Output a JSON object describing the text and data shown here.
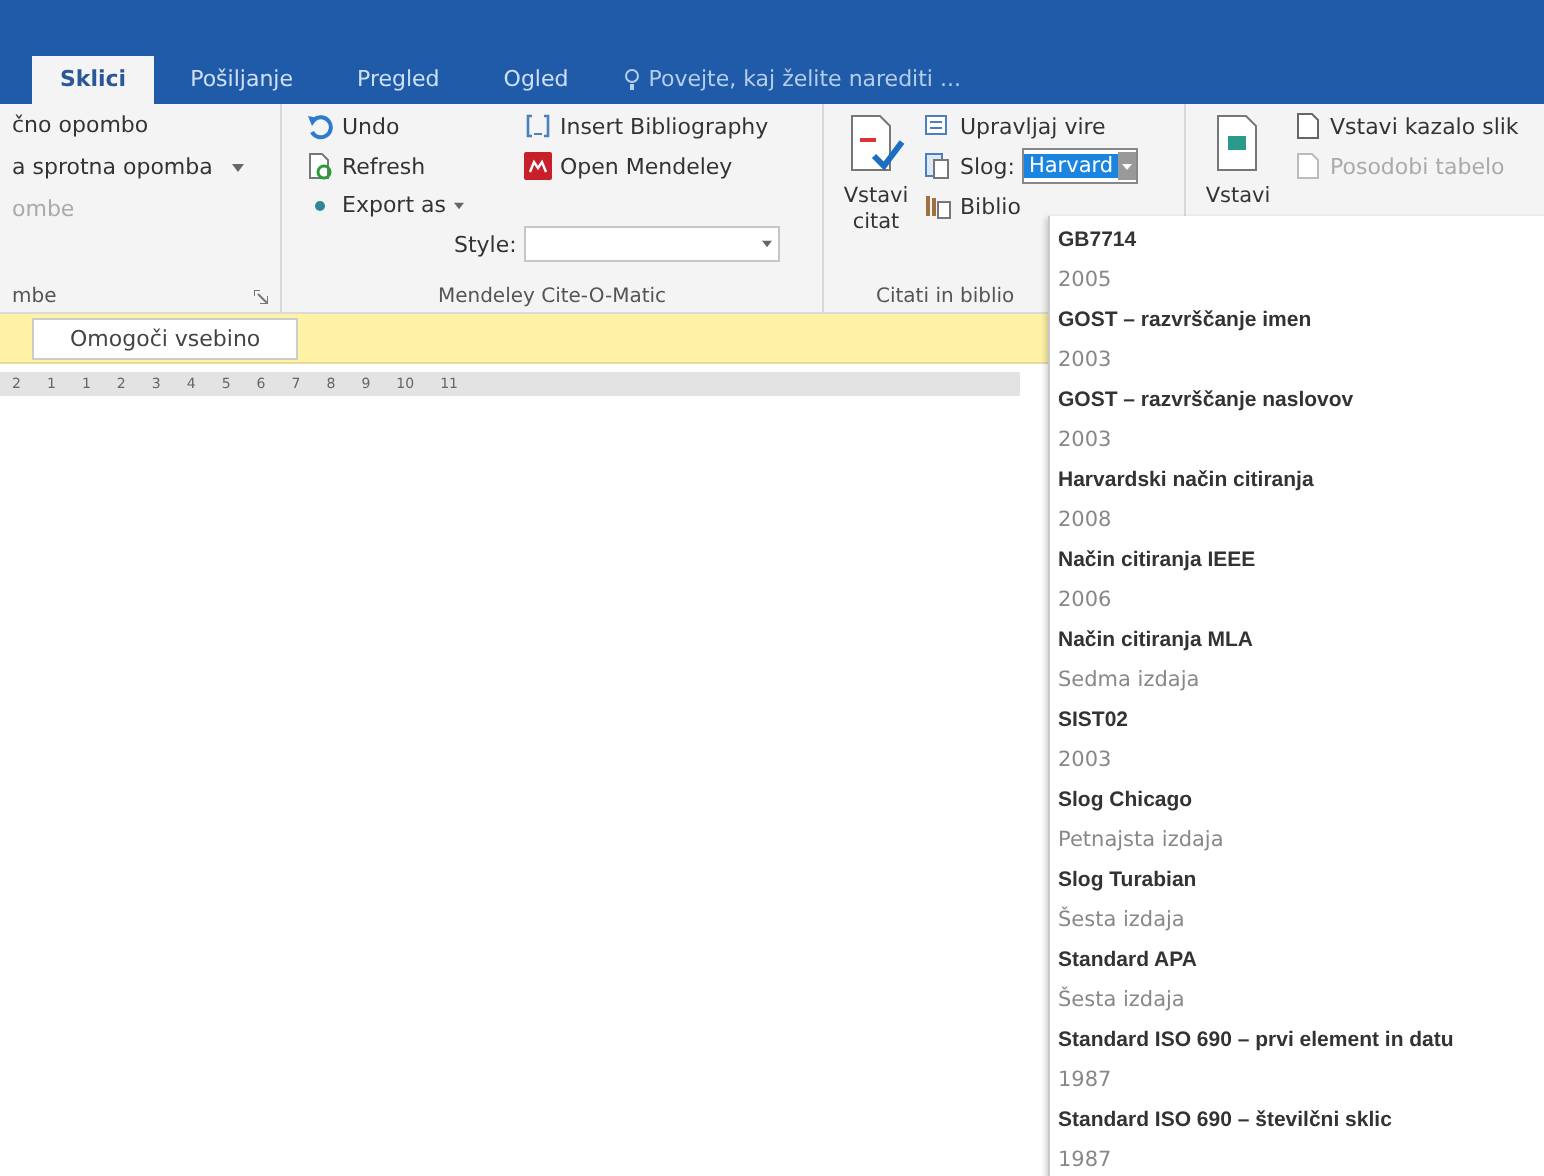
{
  "tabs": [
    {
      "label": "Sklici",
      "selected": true
    },
    {
      "label": "Pošiljanje",
      "selected": false
    },
    {
      "label": "Pregled",
      "selected": false
    },
    {
      "label": "Ogled",
      "selected": false
    }
  ],
  "tell_me": "Povejte, kaj želite narediti ...",
  "ribbon": {
    "footnotes": {
      "items": [
        {
          "label": "čno opombo",
          "disabled": false
        },
        {
          "label": "a sprotna opomba",
          "disabled": false,
          "dropdown": true
        },
        {
          "label": "ombe",
          "disabled": true
        }
      ],
      "group_label": "mbe"
    },
    "mendeley": {
      "col1": [
        {
          "kind": "undo",
          "label": "Undo"
        },
        {
          "kind": "refresh",
          "label": "Refresh"
        },
        {
          "kind": "export",
          "label": "Export as"
        }
      ],
      "col2": [
        {
          "kind": "bibliography",
          "label": "Insert Bibliography"
        },
        {
          "kind": "mendeley",
          "label": "Open Mendeley"
        }
      ],
      "style_label": "Style:",
      "group_label": "Mendeley Cite-O-Matic"
    },
    "citations": {
      "insert": "Vstavi citat",
      "manage": "Upravljaj vire",
      "style_label": "Slog:",
      "style_value": "Harvard",
      "bibliography": "Biblio",
      "group_label": "Citati in biblio"
    },
    "captions": {
      "insert": "Vstavi",
      "items": [
        {
          "label": "Vstavi kazalo slik",
          "disabled": false
        },
        {
          "label": "Posodobi tabelo",
          "disabled": true
        }
      ]
    }
  },
  "message_bar": {
    "button": "Omogoči vsebino"
  },
  "ruler": [
    "2",
    "1",
    "1",
    "2",
    "3",
    "4",
    "5",
    "6",
    "7",
    "8",
    "9",
    "10",
    "11"
  ],
  "style_menu": [
    {
      "name": "GB7714",
      "detail": "2005"
    },
    {
      "name": "GOST – razvrščanje imen",
      "detail": "2003"
    },
    {
      "name": "GOST – razvrščanje naslovov",
      "detail": "2003"
    },
    {
      "name": "Harvardski način citiranja",
      "detail": "2008"
    },
    {
      "name": "Način citiranja IEEE",
      "detail": "2006"
    },
    {
      "name": "Način citiranja MLA",
      "detail": "Sedma izdaja"
    },
    {
      "name": "SIST02",
      "detail": "2003"
    },
    {
      "name": "Slog Chicago",
      "detail": "Petnajsta izdaja"
    },
    {
      "name": "Slog Turabian",
      "detail": "Šesta izdaja"
    },
    {
      "name": "Standard APA",
      "detail": "Šesta izdaja"
    },
    {
      "name": "Standard ISO 690 – prvi element in datu",
      "detail": "1987"
    },
    {
      "name": "Standard ISO 690 – številčni sklic",
      "detail": "1987"
    }
  ]
}
